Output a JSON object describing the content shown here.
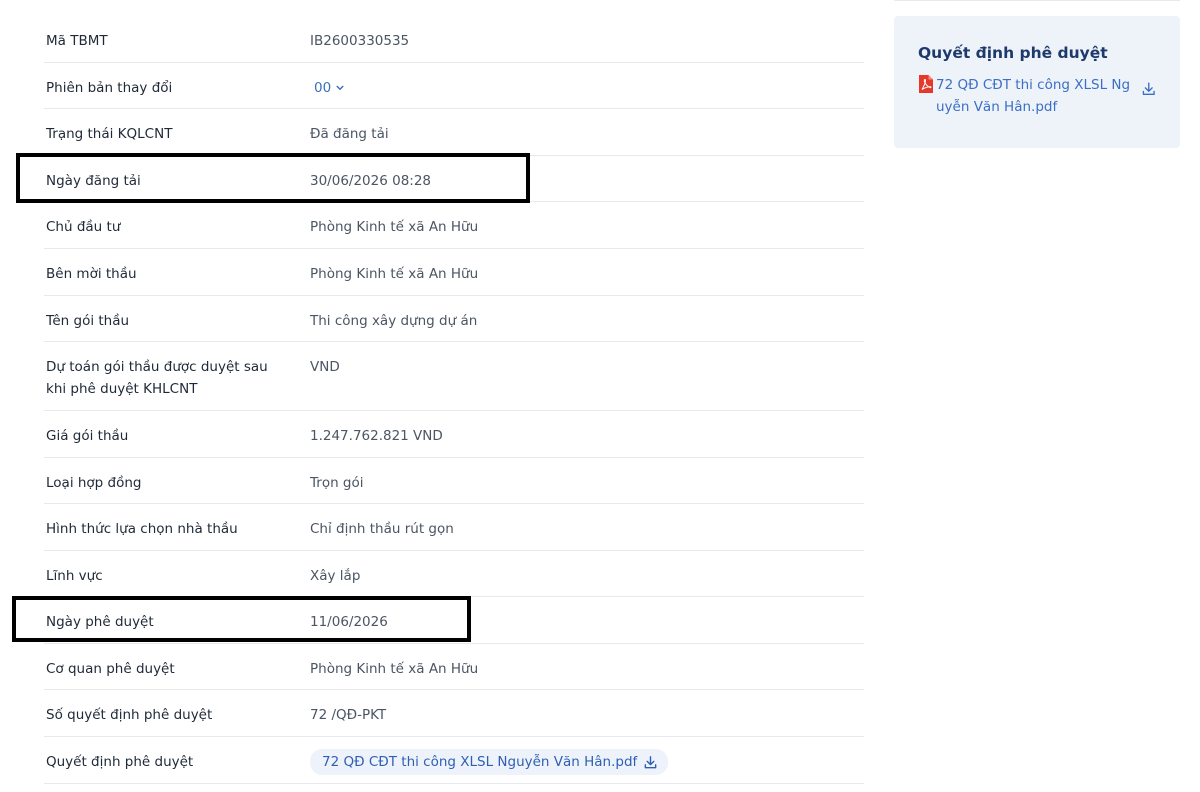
{
  "rows": [
    {
      "label": "Mã TBMT",
      "value": "IB2600330535"
    },
    {
      "label": "Phiên bản thay đổi",
      "value": "00"
    },
    {
      "label": "Trạng thái KQLCNT",
      "value": "Đã đăng tải"
    },
    {
      "label": "Ngày đăng tải",
      "value": "30/06/2026 08:28"
    },
    {
      "label": "Chủ đầu tư",
      "value": "Phòng Kinh tế xã An Hữu"
    },
    {
      "label": "Bên mời thầu",
      "value": "Phòng Kinh tế xã An Hữu"
    },
    {
      "label": "Tên gói thầu",
      "value": "Thi công xây dựng dự án"
    },
    {
      "label": "Dự toán gói thầu được duyệt sau khi phê duyệt KHLCNT",
      "value": "VND"
    },
    {
      "label": "Giá gói thầu",
      "value": "1.247.762.821 VND"
    },
    {
      "label": "Loại hợp đồng",
      "value": "Trọn gói"
    },
    {
      "label": "Hình thức lựa chọn nhà thầu",
      "value": "Chỉ định thầu rút gọn"
    },
    {
      "label": "Lĩnh vực",
      "value": "Xây lắp"
    },
    {
      "label": "Ngày phê duyệt",
      "value": "11/06/2026"
    },
    {
      "label": "Cơ quan phê duyệt",
      "value": "Phòng Kinh tế xã An Hữu"
    },
    {
      "label": "Số quyết định phê duyệt",
      "value": "72 /QĐ-PKT"
    },
    {
      "label": "Quyết định phê duyệt",
      "value": "72 QĐ CĐT thi công XLSL Nguyễn Văn Hân.pdf"
    }
  ],
  "side_panel": {
    "title": "Quyết định phê duyệt",
    "file_name": "72 QĐ CĐT thi công XLSL Nguyễn Văn Hân.pdf",
    "file_icon": "pdf-file-icon",
    "download_icon": "download-icon"
  },
  "colors": {
    "link": "#3b6fc4",
    "panel_bg": "#eef3fa",
    "panel_title": "#1e3a6b",
    "pdf_red": "#e5392b",
    "highlight": "#000000"
  }
}
